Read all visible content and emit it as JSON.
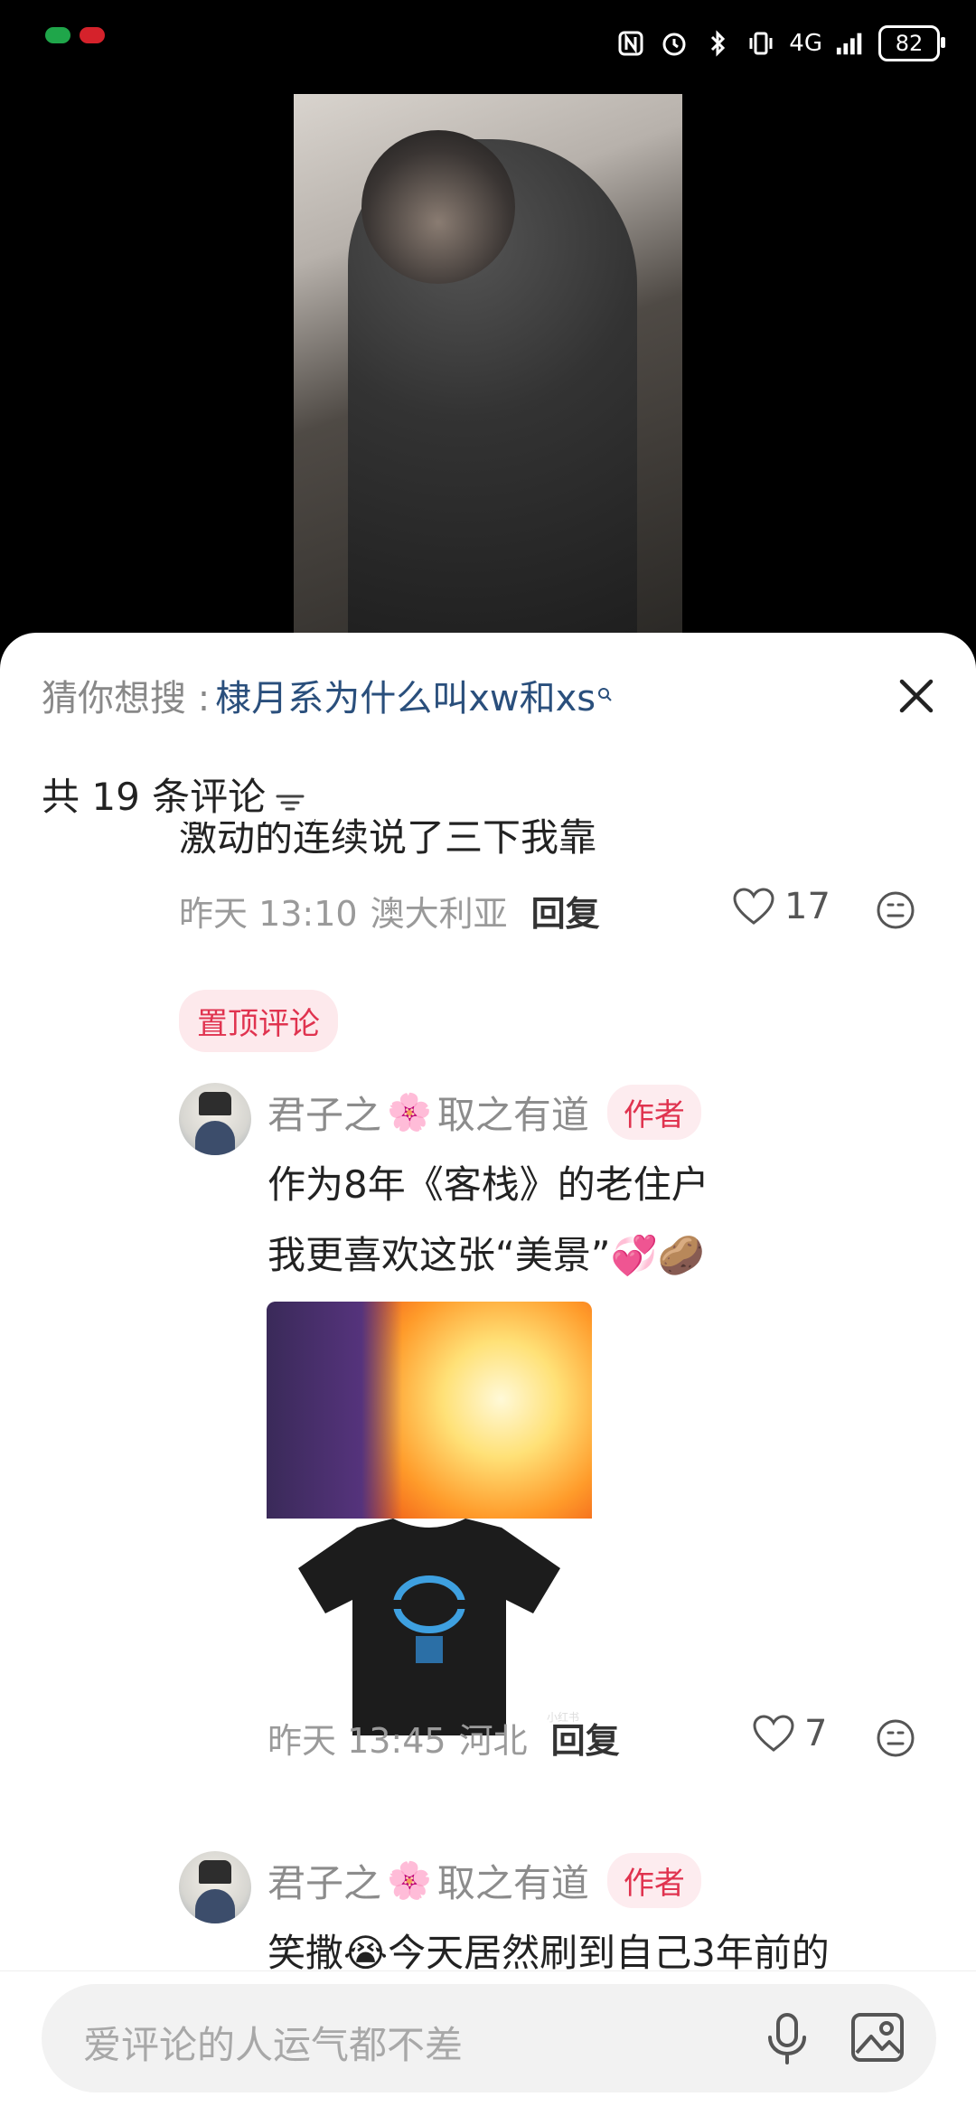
{
  "status_bar": {
    "battery": "82",
    "network": "4G"
  },
  "search_suggest": {
    "prefix": "猜你想搜 :",
    "keyword": "棣月系为什么叫xw和xs"
  },
  "comments_header": {
    "count_label": "共 19 条评论"
  },
  "pinned_comment": {
    "text_line": "激动的连续说了三下我靠",
    "time": "昨天 13:10",
    "location": "澳大利亚",
    "reply": "回复",
    "likes": "17",
    "pinned_tag": "置顶评论"
  },
  "reply1": {
    "username_a": "君子之",
    "username_b": "取之有道",
    "author_tag": "作者",
    "line1": "作为8年《客栈》的老住户",
    "line2": "我更喜欢这张“美景”💞🥔",
    "image_watermark": "小红书",
    "time": "昨天 13:45",
    "location": "河北",
    "reply": "回复",
    "likes": "7"
  },
  "reply2": {
    "username_a": "君子之",
    "username_b": "取之有道",
    "author_tag": "作者",
    "line1": "笑撒😭今天居然刷到自己3年前的"
  },
  "input": {
    "placeholder": "爱评论的人运气都不差"
  },
  "icons": [
    "close-icon",
    "sort-icon",
    "heart-icon",
    "emoji-icon",
    "mic-icon",
    "image-icon",
    "search-mini-icon"
  ],
  "colors": {
    "accent_red": "#e0334f",
    "link_blue": "#2a4f7c"
  }
}
